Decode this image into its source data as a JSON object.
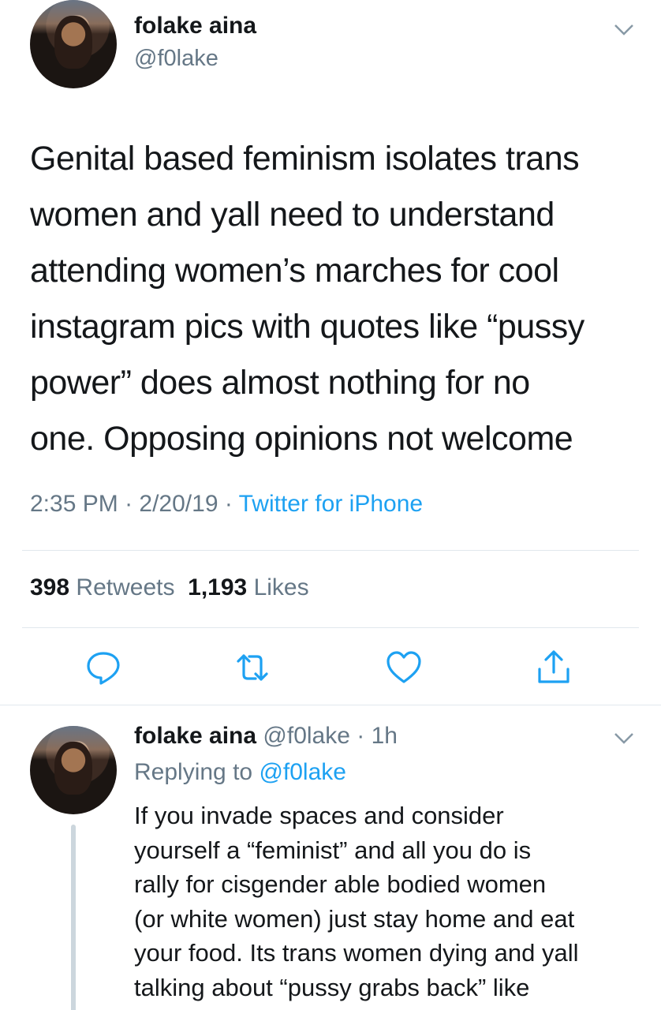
{
  "tweet": {
    "author": {
      "name": "folake aina",
      "handle": "@f0lake"
    },
    "text": "Genital based feminism isolates trans\nwomen and yall need to understand\nattending women’s marches for cool\ninstagram pics with quotes like “pussy\npower” does almost nothing for no\none. Opposing opinions not welcome",
    "time": "2:35 PM",
    "date": "2/20/19",
    "separator": " · ",
    "source": "Twitter for iPhone",
    "stats": {
      "retweets_count": "398",
      "retweets_label": "Retweets",
      "likes_count": "1,193",
      "likes_label": "Likes"
    },
    "actions": [
      "reply-icon",
      "retweet-icon",
      "like-icon",
      "share-icon"
    ]
  },
  "reply": {
    "author": {
      "name": "folake aina",
      "handle": "@f0lake"
    },
    "age": "1h",
    "dot": " · ",
    "replying_prefix": "Replying to ",
    "replying_to": "@f0lake",
    "text": "If you invade spaces and consider\nyourself a “feminist” and all you do is\nrally for cisgender able bodied women\n(or white women) just stay home and eat\nyour food. Its trans women dying and yall\ntalking about “pussy grabs back” like"
  },
  "colors": {
    "text": "#14171a",
    "secondary": "#657786",
    "accent": "#1da1f2",
    "divider": "#e1e8ed",
    "thread_line": "#ccd6dd"
  }
}
